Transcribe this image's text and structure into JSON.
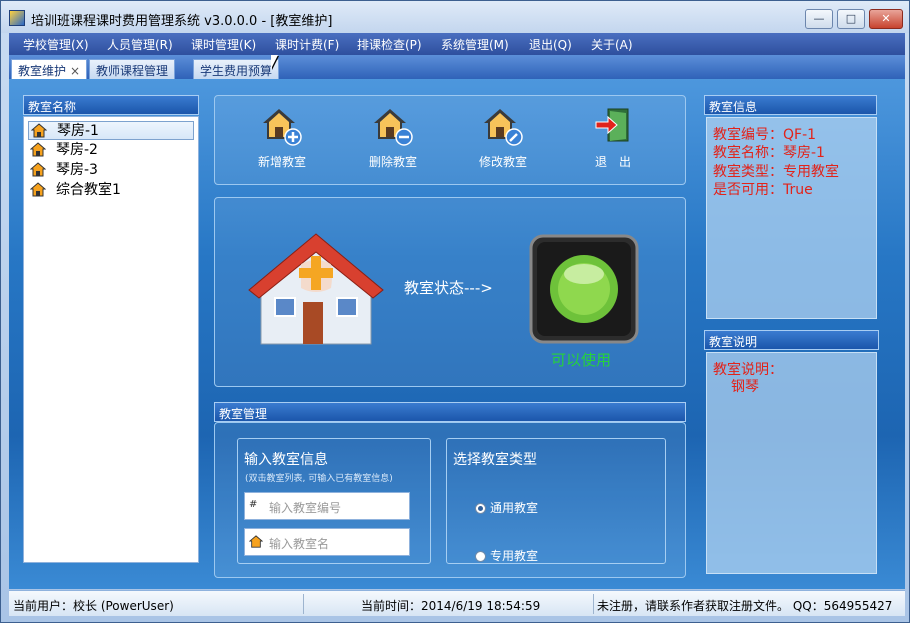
{
  "window": {
    "title": "培训班课程课时费用管理系统  v3.0.0.0 - [教室维护]",
    "controls": {
      "minimize": "—",
      "maximize": "□",
      "close": "✕"
    }
  },
  "menubar": {
    "items": [
      "学校管理(X)",
      "人员管理(R)",
      "课时管理(K)",
      "课时计费(F)",
      "排课检查(P)",
      "系统管理(M)",
      "退出(Q)",
      "关于(A)"
    ]
  },
  "tabs": [
    {
      "label": "教室维护",
      "close": "×",
      "active": true
    },
    {
      "label": "教师课程管理",
      "active": false
    },
    {
      "label": "学生费用预算",
      "active": false
    }
  ],
  "room_list": {
    "header": "教室名称",
    "items": [
      "琴房-1",
      "琴房-2",
      "琴房-3",
      "综合教室1"
    ],
    "selected_index": 0
  },
  "toolbar": {
    "add": "新增教室",
    "delete": "删除教室",
    "edit": "修改教室",
    "exit": "退　出"
  },
  "status_panel": {
    "label": "教室状态--->",
    "state": "可以使用",
    "state_color": "#25d23c"
  },
  "management": {
    "header": "教室管理",
    "input_group": {
      "title": "输入教室信息",
      "hint": "(双击教室列表, 可输入已有教室信息)",
      "code_placeholder": "输入教室编号",
      "name_placeholder": "输入教室名"
    },
    "type_group": {
      "title": "选择教室类型",
      "options": [
        "通用教室",
        "专用教室"
      ],
      "selected": "通用教室"
    }
  },
  "info_panel": {
    "header": "教室信息",
    "lines": [
      "教室编号：QF-1",
      "教室名称：琴房-1",
      "教室类型：专用教室",
      "是否可用：True"
    ]
  },
  "desc_panel": {
    "header": "教室说明",
    "label": "教室说明：",
    "text": "钢琴"
  },
  "statusbar": {
    "user": "当前用户：校长 (PowerUser)",
    "time": "当前时间：2014/6/19 18:54:59",
    "notice": "未注册，请联系作者获取注册文件。   QQ：564955427"
  },
  "colors": {
    "accent": "#2777c5",
    "info_text": "#e2231a"
  }
}
